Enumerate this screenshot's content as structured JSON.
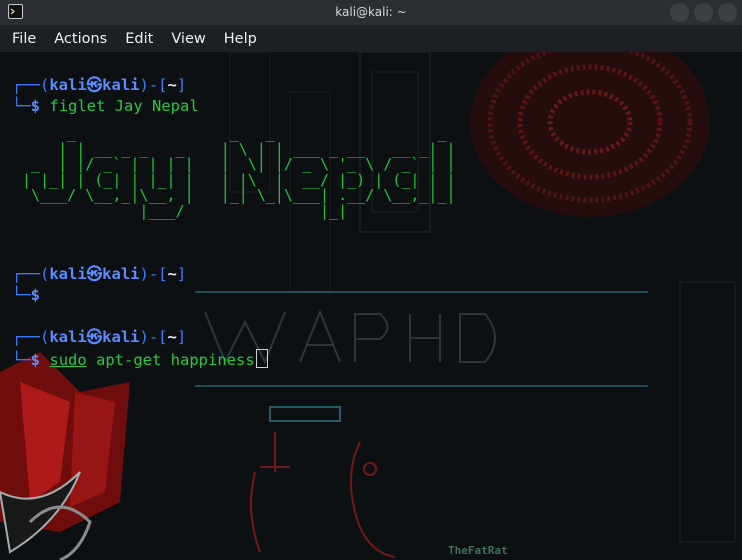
{
  "window": {
    "title": "kali@kali: ~"
  },
  "menu": [
    "File",
    "Actions",
    "Edit",
    "View",
    "Help"
  ],
  "prompt": {
    "user": "kali",
    "host": "kali",
    "dir": "~",
    "symbol": "$"
  },
  "commands": [
    {
      "text": "figlet Jay Nepal",
      "executed": true
    },
    {
      "text": "",
      "executed": true
    },
    {
      "text": "sudo apt-get happiness",
      "executed": false
    }
  ],
  "figlet_output": [
    "      _                 _   _                  _ ",
    "     | | __ _ _   _    | \\ | | ___ _ __   __ _| |",
    "  _  | |/ _` | | | |   |  \\| |/ _ \\ '_ \\ / _` | |",
    " | |_| | (_| | |_| |   | |\\  |  __/ |_) | (_| | |",
    "  \\___/ \\__,_|\\__, |   |_| \\_|\\___| .__/ \\__,_|_|",
    "              |___/               |_|            "
  ],
  "wallpaper": {
    "credit": "TheFatRat"
  },
  "colors": {
    "prompt_blue": "#4e78ff",
    "command_green": "#27c93f",
    "titlebar": "#2b2f33",
    "menubar": "#1c1f23",
    "wallpaper_red": "#a01818"
  }
}
